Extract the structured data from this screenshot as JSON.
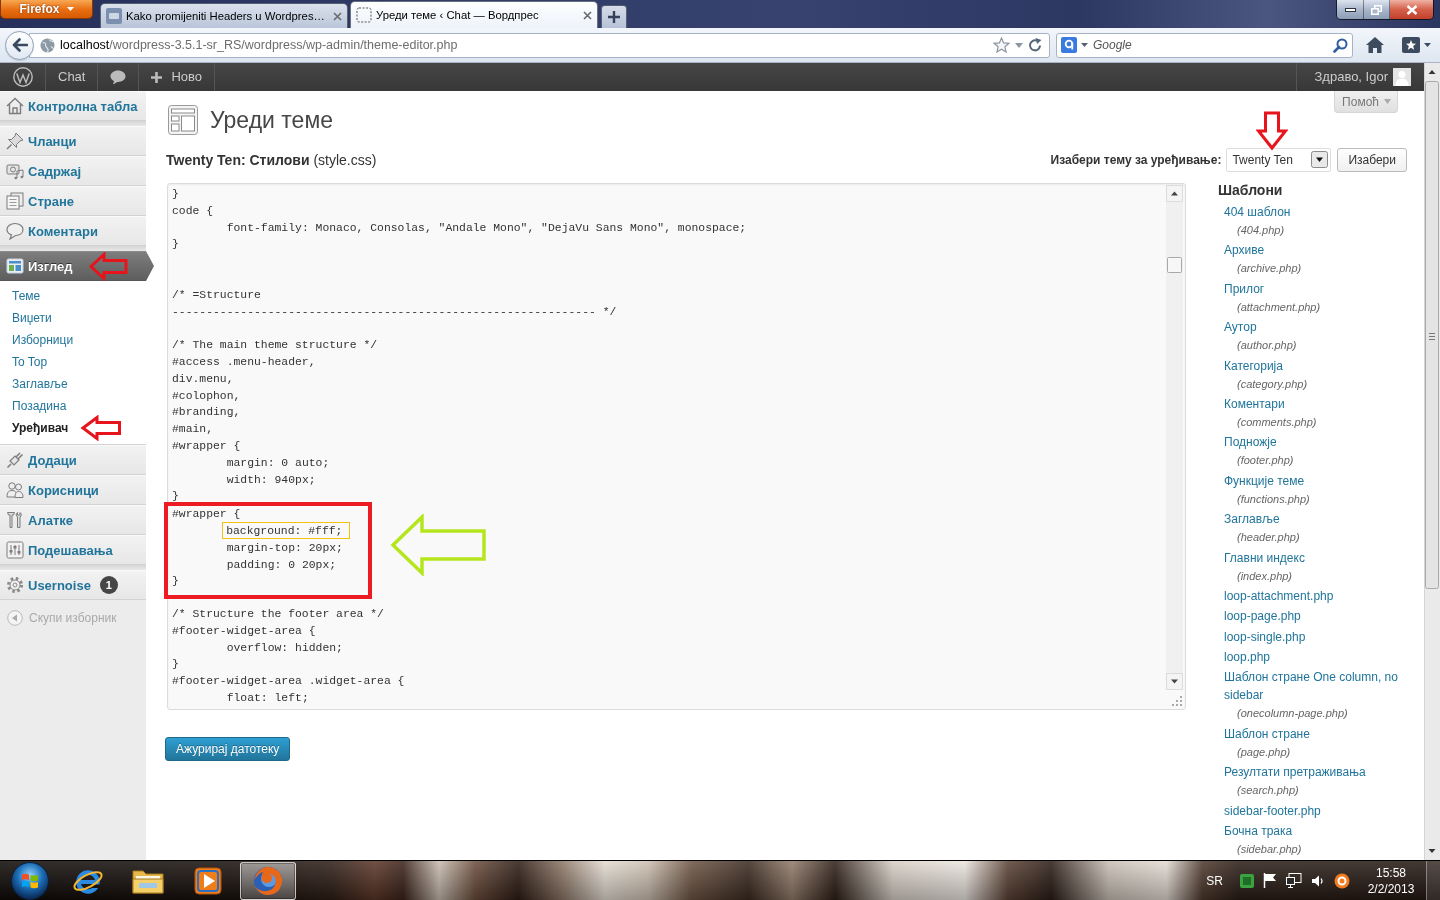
{
  "browser": {
    "menu_button": "Firefox",
    "tabs": [
      {
        "title": "Kako promijeniti Headers u Wordpres…",
        "selected": false
      },
      {
        "title": "Уреди теме ‹ Chat — Вордпрес",
        "selected": true
      }
    ],
    "address": {
      "host": "localhost",
      "path": "/wordpress-3.5.1-sr_RS/wordpress/wp-admin/theme-editor.php"
    },
    "search": {
      "placeholder": "Google"
    }
  },
  "admin_bar": {
    "site": "Chat",
    "new": "Ново",
    "greeting": "Здраво, Igor"
  },
  "sidebar": {
    "groups": [
      {
        "items": [
          {
            "label": "Контролна табла",
            "selected": false,
            "arrow_annotation": false
          }
        ]
      },
      {
        "items": [
          {
            "label": "Чланци",
            "selected": false,
            "arrow_annotation": false
          },
          {
            "label": "Садржај",
            "selected": false,
            "arrow_annotation": false
          },
          {
            "label": "Стране",
            "selected": false,
            "arrow_annotation": false
          },
          {
            "label": "Коментари",
            "selected": false,
            "arrow_annotation": false
          }
        ]
      },
      {
        "items": [
          {
            "label": "Изглед",
            "selected": true,
            "arrow_annotation": true,
            "submenu": [
              {
                "label": "Теме",
                "selected": false,
                "arrow_annotation": false
              },
              {
                "label": "Виџети",
                "selected": false,
                "arrow_annotation": false
              },
              {
                "label": "Изборници",
                "selected": false,
                "arrow_annotation": false
              },
              {
                "label": "To Top",
                "selected": false,
                "arrow_annotation": false
              },
              {
                "label": "Заглавље",
                "selected": false,
                "arrow_annotation": false
              },
              {
                "label": "Позадина",
                "selected": false,
                "arrow_annotation": false
              },
              {
                "label": "Уређивач",
                "selected": true,
                "arrow_annotation": true
              }
            ]
          },
          {
            "label": "Додаци",
            "selected": false,
            "arrow_annotation": false
          },
          {
            "label": "Корисници",
            "selected": false,
            "arrow_annotation": false
          },
          {
            "label": "Алатке",
            "selected": false,
            "arrow_annotation": false
          },
          {
            "label": "Подешавања",
            "selected": false,
            "arrow_annotation": false
          }
        ]
      },
      {
        "items": [
          {
            "label": "Usernoise",
            "badge": "1",
            "selected": false,
            "arrow_annotation": false
          }
        ]
      }
    ],
    "collapse": "Скупи изборник"
  },
  "page": {
    "help_tab": "Помоћ",
    "title": "Уреди теме",
    "file_heading": "**Twenty Ten: Стилови** (style.css)",
    "theme_picker": {
      "label": "Изабери тему за уређивање:",
      "value": "Twenty Ten",
      "button": "Изабери",
      "arrow_annotation": true
    },
    "editor": {
      "blocks": [
        {
          "boxed": false,
          "arrow_annotation": false,
          "segments": [
            {
              "text": "}\ncode {\n\tfont-family: Monaco, Consolas, \"Andale Mono\", \"DejaVu Sans Mono\", monospace;\n}\n\n\n/* =Structure\n-------------------------------------------------------------- */\n\n/* The main theme structure */\n#access .menu-header,\ndiv.menu,\n#colophon,\n#branding,\n#main,\n#wrapper {\n\tmargin: 0 auto;\n\twidth: 940px;\n}",
              "highlighted": false
            }
          ]
        },
        {
          "boxed": true,
          "arrow_annotation": true,
          "segments": [
            {
              "text": "#wrapper {\n\t",
              "highlighted": false
            },
            {
              "text": "background: #fff;",
              "highlighted": true
            },
            {
              "text": "\n\tmargin-top: 20px;\n\tpadding: 0 20px;\n}",
              "highlighted": false
            }
          ]
        },
        {
          "boxed": false,
          "arrow_annotation": false,
          "segments": [
            {
              "text": "\n/* Structure the footer area */\n#footer-widget-area {\n\toverflow: hidden;\n}\n#footer-widget-area .widget-area {\n\tfloat: left;",
              "highlighted": false
            }
          ]
        }
      ]
    },
    "update_button": "Ажурирај датотеку",
    "templates": {
      "heading": "Шаблони",
      "items": [
        {
          "name": "404 шаблон",
          "file": "(404.php)"
        },
        {
          "name": "Архиве",
          "file": "(archive.php)"
        },
        {
          "name": "Прилог",
          "file": "(attachment.php)"
        },
        {
          "name": "Аутор",
          "file": "(author.php)"
        },
        {
          "name": "Категорија",
          "file": "(category.php)"
        },
        {
          "name": "Коментари",
          "file": "(comments.php)"
        },
        {
          "name": "Подножје",
          "file": "(footer.php)"
        },
        {
          "name": "Функције теме",
          "file": "(functions.php)"
        },
        {
          "name": "Заглавље",
          "file": "(header.php)"
        },
        {
          "name": "Главни индекс",
          "file": "(index.php)"
        },
        {
          "name": "loop-attachment.php"
        },
        {
          "name": "loop-page.php"
        },
        {
          "name": "loop-single.php"
        },
        {
          "name": "loop.php"
        },
        {
          "name": "Шаблон стране One column, no sidebar",
          "file": "(onecolumn-page.php)"
        },
        {
          "name": "Шаблон стране",
          "file": "(page.php)"
        },
        {
          "name": "Резултати претраживања",
          "file": "(search.php)"
        },
        {
          "name": "sidebar-footer.php"
        },
        {
          "name": "Бочна трака",
          "file": "(sidebar.php)"
        }
      ]
    }
  },
  "taskbar": {
    "apps": [
      {
        "kind": "browser",
        "selected": false
      },
      {
        "kind": "files",
        "selected": false
      },
      {
        "kind": "media",
        "selected": false
      },
      {
        "kind": "firefox",
        "selected": true
      }
    ],
    "language": "SR",
    "time": "15:58",
    "date": "2/2/2013"
  }
}
